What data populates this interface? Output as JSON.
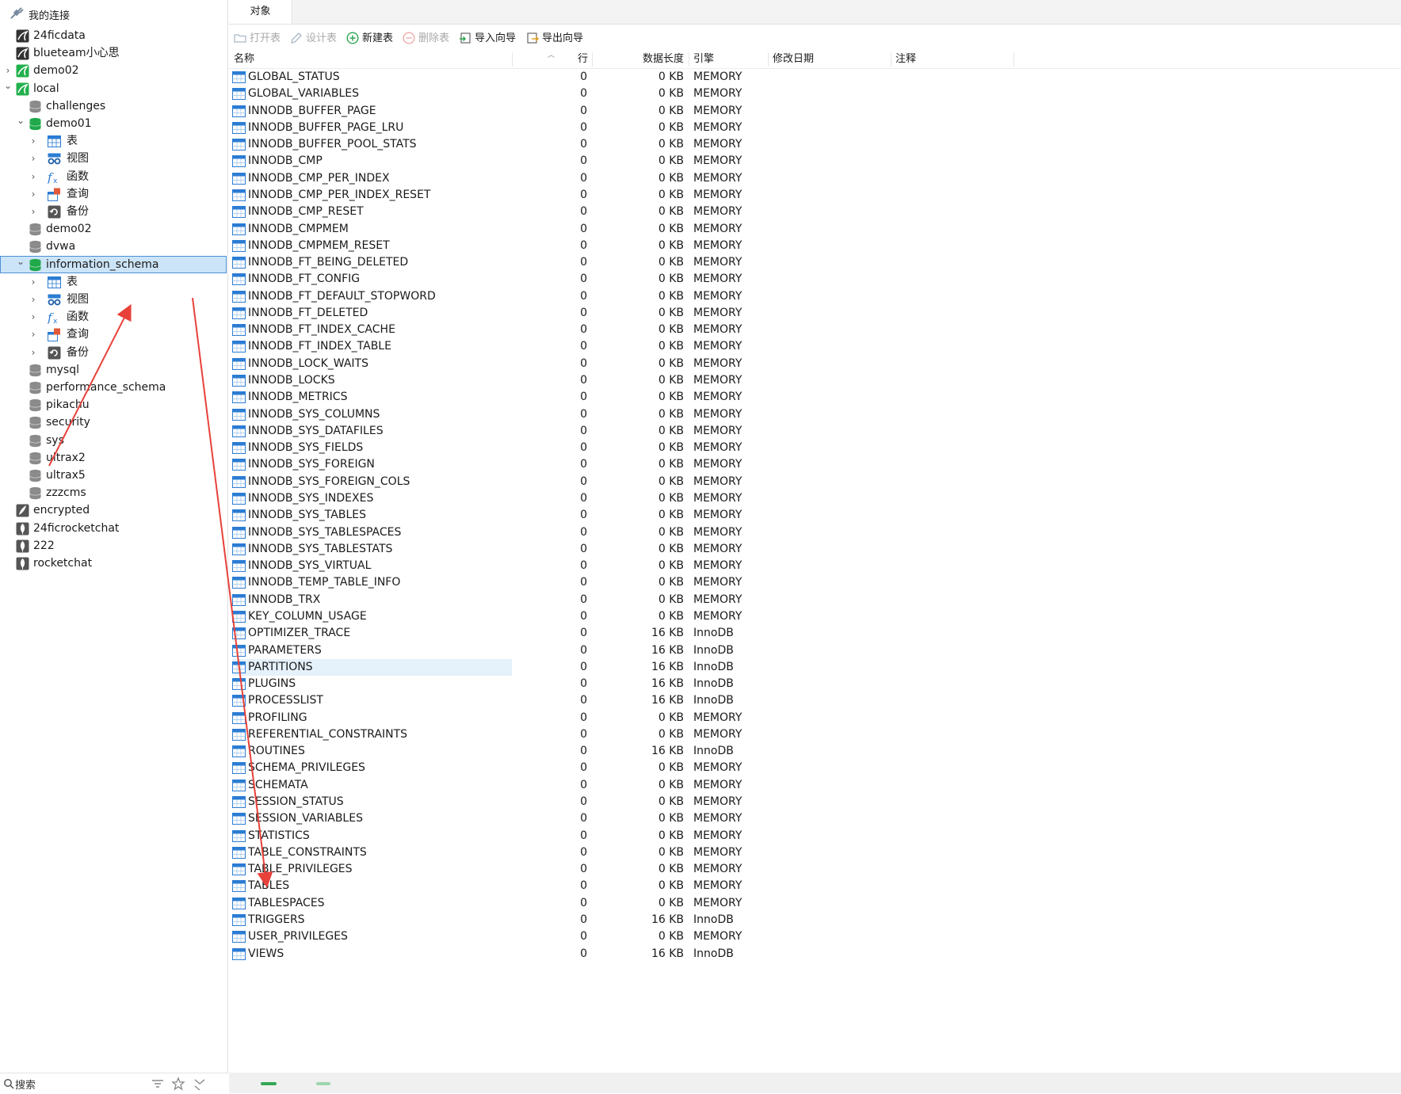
{
  "left_header": {
    "title": "我的连接",
    "icon": "connection-plug-icon"
  },
  "tree": [
    {
      "label": "24ficdata",
      "level": 0,
      "chev": "",
      "icon": "mysql-connection-icon",
      "color": "#333333"
    },
    {
      "label": "blueteam小心思",
      "level": 0,
      "chev": "",
      "icon": "mysql-connection-icon",
      "color": "#333333"
    },
    {
      "label": "demo02",
      "level": 0,
      "chev": "right",
      "icon": "mysql-connection-green-icon",
      "color": "#22b14c"
    },
    {
      "label": "local",
      "level": 0,
      "chev": "down",
      "icon": "mysql-connection-green-icon",
      "color": "#22b14c"
    },
    {
      "label": "challenges",
      "level": 1,
      "chev": "",
      "icon": "database-gray-icon",
      "color": "#8a8a8a"
    },
    {
      "label": "demo01",
      "level": 1,
      "chev": "down",
      "icon": "database-green-icon",
      "color": "#1fa84a"
    },
    {
      "label": "表",
      "level": 2,
      "chev": "right",
      "icon": "table-folder-icon",
      "color": "#2b7cd3"
    },
    {
      "label": "视图",
      "level": 2,
      "chev": "right",
      "icon": "view-glasses-icon",
      "color": "#2b7cd3"
    },
    {
      "label": "函数",
      "level": 2,
      "chev": "right",
      "icon": "function-fx-icon",
      "color": "#2b7cd3"
    },
    {
      "label": "查询",
      "level": 2,
      "chev": "right",
      "icon": "query-icon",
      "color": "#e05a3a"
    },
    {
      "label": "备份",
      "level": 2,
      "chev": "right",
      "icon": "backup-icon",
      "color": "#555555"
    },
    {
      "label": "demo02",
      "level": 1,
      "chev": "",
      "icon": "database-gray-icon",
      "color": "#8a8a8a"
    },
    {
      "label": "dvwa",
      "level": 1,
      "chev": "",
      "icon": "database-gray-icon",
      "color": "#8a8a8a"
    },
    {
      "label": "information_schema",
      "level": 1,
      "chev": "down",
      "icon": "database-green-icon",
      "color": "#1fa84a",
      "selected": true
    },
    {
      "label": "表",
      "level": 2,
      "chev": "right",
      "icon": "table-folder-icon",
      "color": "#2b7cd3"
    },
    {
      "label": "视图",
      "level": 2,
      "chev": "right",
      "icon": "view-glasses-icon",
      "color": "#2b7cd3"
    },
    {
      "label": "函数",
      "level": 2,
      "chev": "right",
      "icon": "function-fx-icon",
      "color": "#2b7cd3"
    },
    {
      "label": "查询",
      "level": 2,
      "chev": "right",
      "icon": "query-icon",
      "color": "#e05a3a"
    },
    {
      "label": "备份",
      "level": 2,
      "chev": "right",
      "icon": "backup-icon",
      "color": "#555555"
    },
    {
      "label": "mysql",
      "level": 1,
      "chev": "",
      "icon": "database-gray-icon",
      "color": "#8a8a8a"
    },
    {
      "label": "performance_schema",
      "level": 1,
      "chev": "",
      "icon": "database-gray-icon",
      "color": "#8a8a8a"
    },
    {
      "label": "pikachu",
      "level": 1,
      "chev": "",
      "icon": "database-gray-icon",
      "color": "#8a8a8a"
    },
    {
      "label": "security",
      "level": 1,
      "chev": "",
      "icon": "database-gray-icon",
      "color": "#8a8a8a"
    },
    {
      "label": "sys",
      "level": 1,
      "chev": "",
      "icon": "database-gray-icon",
      "color": "#8a8a8a"
    },
    {
      "label": "ultrax2",
      "level": 1,
      "chev": "",
      "icon": "database-gray-icon",
      "color": "#8a8a8a"
    },
    {
      "label": "ultrax5",
      "level": 1,
      "chev": "",
      "icon": "database-gray-icon",
      "color": "#8a8a8a"
    },
    {
      "label": "zzzcms",
      "level": 1,
      "chev": "",
      "icon": "database-gray-icon",
      "color": "#8a8a8a"
    },
    {
      "label": "encrypted",
      "level": 0,
      "chev": "",
      "icon": "sqlite-feather-icon",
      "color": "#555555"
    },
    {
      "label": "24ficrocketchat",
      "level": 0,
      "chev": "",
      "icon": "mongodb-leaf-icon",
      "color": "#555555"
    },
    {
      "label": "222",
      "level": 0,
      "chev": "",
      "icon": "mongodb-leaf-icon",
      "color": "#555555"
    },
    {
      "label": "rocketchat",
      "level": 0,
      "chev": "",
      "icon": "mongodb-leaf-icon",
      "color": "#555555"
    }
  ],
  "search": {
    "label": "搜索"
  },
  "tabs": {
    "objects": "对象"
  },
  "toolbar": {
    "open": "打开表",
    "design": "设计表",
    "new": "新建表",
    "delete": "删除表",
    "import": "导入向导",
    "export": "导出向导"
  },
  "columns": {
    "name": "名称",
    "rows": "行",
    "length": "数据长度",
    "engine": "引擎",
    "modified": "修改日期",
    "comment": "注释"
  },
  "tables": [
    {
      "name": "GLOBAL_STATUS",
      "rows": "0",
      "len": "0 KB",
      "engine": "MEMORY"
    },
    {
      "name": "GLOBAL_VARIABLES",
      "rows": "0",
      "len": "0 KB",
      "engine": "MEMORY"
    },
    {
      "name": "INNODB_BUFFER_PAGE",
      "rows": "0",
      "len": "0 KB",
      "engine": "MEMORY"
    },
    {
      "name": "INNODB_BUFFER_PAGE_LRU",
      "rows": "0",
      "len": "0 KB",
      "engine": "MEMORY"
    },
    {
      "name": "INNODB_BUFFER_POOL_STATS",
      "rows": "0",
      "len": "0 KB",
      "engine": "MEMORY"
    },
    {
      "name": "INNODB_CMP",
      "rows": "0",
      "len": "0 KB",
      "engine": "MEMORY"
    },
    {
      "name": "INNODB_CMP_PER_INDEX",
      "rows": "0",
      "len": "0 KB",
      "engine": "MEMORY"
    },
    {
      "name": "INNODB_CMP_PER_INDEX_RESET",
      "rows": "0",
      "len": "0 KB",
      "engine": "MEMORY"
    },
    {
      "name": "INNODB_CMP_RESET",
      "rows": "0",
      "len": "0 KB",
      "engine": "MEMORY"
    },
    {
      "name": "INNODB_CMPMEM",
      "rows": "0",
      "len": "0 KB",
      "engine": "MEMORY"
    },
    {
      "name": "INNODB_CMPMEM_RESET",
      "rows": "0",
      "len": "0 KB",
      "engine": "MEMORY"
    },
    {
      "name": "INNODB_FT_BEING_DELETED",
      "rows": "0",
      "len": "0 KB",
      "engine": "MEMORY"
    },
    {
      "name": "INNODB_FT_CONFIG",
      "rows": "0",
      "len": "0 KB",
      "engine": "MEMORY"
    },
    {
      "name": "INNODB_FT_DEFAULT_STOPWORD",
      "rows": "0",
      "len": "0 KB",
      "engine": "MEMORY"
    },
    {
      "name": "INNODB_FT_DELETED",
      "rows": "0",
      "len": "0 KB",
      "engine": "MEMORY"
    },
    {
      "name": "INNODB_FT_INDEX_CACHE",
      "rows": "0",
      "len": "0 KB",
      "engine": "MEMORY"
    },
    {
      "name": "INNODB_FT_INDEX_TABLE",
      "rows": "0",
      "len": "0 KB",
      "engine": "MEMORY"
    },
    {
      "name": "INNODB_LOCK_WAITS",
      "rows": "0",
      "len": "0 KB",
      "engine": "MEMORY"
    },
    {
      "name": "INNODB_LOCKS",
      "rows": "0",
      "len": "0 KB",
      "engine": "MEMORY"
    },
    {
      "name": "INNODB_METRICS",
      "rows": "0",
      "len": "0 KB",
      "engine": "MEMORY"
    },
    {
      "name": "INNODB_SYS_COLUMNS",
      "rows": "0",
      "len": "0 KB",
      "engine": "MEMORY"
    },
    {
      "name": "INNODB_SYS_DATAFILES",
      "rows": "0",
      "len": "0 KB",
      "engine": "MEMORY"
    },
    {
      "name": "INNODB_SYS_FIELDS",
      "rows": "0",
      "len": "0 KB",
      "engine": "MEMORY"
    },
    {
      "name": "INNODB_SYS_FOREIGN",
      "rows": "0",
      "len": "0 KB",
      "engine": "MEMORY"
    },
    {
      "name": "INNODB_SYS_FOREIGN_COLS",
      "rows": "0",
      "len": "0 KB",
      "engine": "MEMORY"
    },
    {
      "name": "INNODB_SYS_INDEXES",
      "rows": "0",
      "len": "0 KB",
      "engine": "MEMORY"
    },
    {
      "name": "INNODB_SYS_TABLES",
      "rows": "0",
      "len": "0 KB",
      "engine": "MEMORY"
    },
    {
      "name": "INNODB_SYS_TABLESPACES",
      "rows": "0",
      "len": "0 KB",
      "engine": "MEMORY"
    },
    {
      "name": "INNODB_SYS_TABLESTATS",
      "rows": "0",
      "len": "0 KB",
      "engine": "MEMORY"
    },
    {
      "name": "INNODB_SYS_VIRTUAL",
      "rows": "0",
      "len": "0 KB",
      "engine": "MEMORY"
    },
    {
      "name": "INNODB_TEMP_TABLE_INFO",
      "rows": "0",
      "len": "0 KB",
      "engine": "MEMORY"
    },
    {
      "name": "INNODB_TRX",
      "rows": "0",
      "len": "0 KB",
      "engine": "MEMORY"
    },
    {
      "name": "KEY_COLUMN_USAGE",
      "rows": "0",
      "len": "0 KB",
      "engine": "MEMORY"
    },
    {
      "name": "OPTIMIZER_TRACE",
      "rows": "0",
      "len": "16 KB",
      "engine": "InnoDB"
    },
    {
      "name": "PARAMETERS",
      "rows": "0",
      "len": "16 KB",
      "engine": "InnoDB"
    },
    {
      "name": "PARTITIONS",
      "rows": "0",
      "len": "16 KB",
      "engine": "InnoDB",
      "hl": true
    },
    {
      "name": "PLUGINS",
      "rows": "0",
      "len": "16 KB",
      "engine": "InnoDB"
    },
    {
      "name": "PROCESSLIST",
      "rows": "0",
      "len": "16 KB",
      "engine": "InnoDB"
    },
    {
      "name": "PROFILING",
      "rows": "0",
      "len": "0 KB",
      "engine": "MEMORY"
    },
    {
      "name": "REFERENTIAL_CONSTRAINTS",
      "rows": "0",
      "len": "0 KB",
      "engine": "MEMORY"
    },
    {
      "name": "ROUTINES",
      "rows": "0",
      "len": "16 KB",
      "engine": "InnoDB"
    },
    {
      "name": "SCHEMA_PRIVILEGES",
      "rows": "0",
      "len": "0 KB",
      "engine": "MEMORY"
    },
    {
      "name": "SCHEMATA",
      "rows": "0",
      "len": "0 KB",
      "engine": "MEMORY"
    },
    {
      "name": "SESSION_STATUS",
      "rows": "0",
      "len": "0 KB",
      "engine": "MEMORY"
    },
    {
      "name": "SESSION_VARIABLES",
      "rows": "0",
      "len": "0 KB",
      "engine": "MEMORY"
    },
    {
      "name": "STATISTICS",
      "rows": "0",
      "len": "0 KB",
      "engine": "MEMORY"
    },
    {
      "name": "TABLE_CONSTRAINTS",
      "rows": "0",
      "len": "0 KB",
      "engine": "MEMORY"
    },
    {
      "name": "TABLE_PRIVILEGES",
      "rows": "0",
      "len": "0 KB",
      "engine": "MEMORY"
    },
    {
      "name": "TABLES",
      "rows": "0",
      "len": "0 KB",
      "engine": "MEMORY"
    },
    {
      "name": "TABLESPACES",
      "rows": "0",
      "len": "0 KB",
      "engine": "MEMORY"
    },
    {
      "name": "TRIGGERS",
      "rows": "0",
      "len": "16 KB",
      "engine": "InnoDB"
    },
    {
      "name": "USER_PRIVILEGES",
      "rows": "0",
      "len": "0 KB",
      "engine": "MEMORY"
    },
    {
      "name": "VIEWS",
      "rows": "0",
      "len": "16 KB",
      "engine": "InnoDB"
    }
  ],
  "colors": {
    "accent": "#2b7cd3",
    "selection": "#cce4f7",
    "annotation_arrow": "#e8413a"
  }
}
